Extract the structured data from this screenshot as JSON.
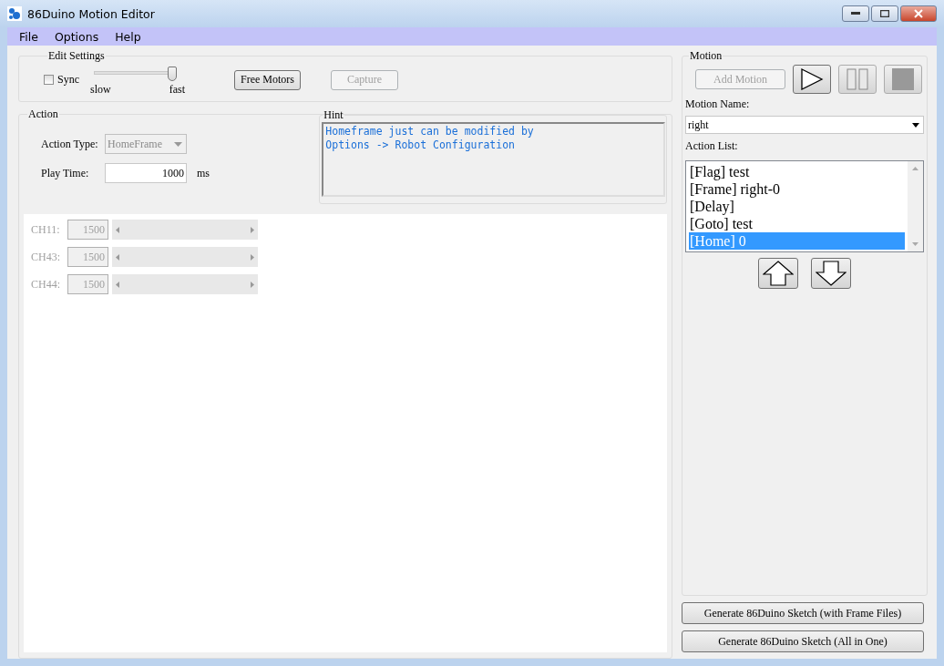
{
  "window": {
    "title": "86Duino Motion Editor"
  },
  "menu": [
    "File",
    "Options",
    "Help"
  ],
  "edit_settings": {
    "title": "Edit Settings",
    "sync": {
      "label": "Sync",
      "checked": false
    },
    "speed": {
      "level": 0.95,
      "min_label": "slow",
      "max_label": "fast"
    },
    "buttons": [
      {
        "label": "Free Motors",
        "disabled": false
      },
      {
        "label": "Capture",
        "disabled": true
      }
    ]
  },
  "action": {
    "title": "Action",
    "action_type": {
      "label": "Action Type:",
      "value": "HomeFrame",
      "disabled": true
    },
    "play_time": {
      "label": "Play Time:",
      "value": "1000",
      "unit": "ms"
    }
  },
  "hint": {
    "title": "Hint",
    "lines": [
      "Homeframe just can be modified by",
      "Options -> Robot Configuration"
    ]
  },
  "channels": [
    {
      "label": "CH11:",
      "value": "1500",
      "disabled": true
    },
    {
      "label": "CH43:",
      "value": "1500",
      "disabled": true
    },
    {
      "label": "CH44:",
      "value": "1500",
      "disabled": true
    }
  ],
  "motion": {
    "title": "Motion",
    "add_button": {
      "label": "Add Motion",
      "disabled": true
    },
    "motion_name": {
      "label": "Motion Name:",
      "value": "right"
    },
    "action_list": {
      "label": "Action List:",
      "items": [
        {
          "text": "[Flag] test",
          "selected": false
        },
        {
          "text": "[Frame] right-0",
          "selected": false
        },
        {
          "text": "[Delay]",
          "selected": false
        },
        {
          "text": "[Goto] test",
          "selected": false
        },
        {
          "text": "[Home] 0",
          "selected": true
        }
      ]
    }
  },
  "generate_buttons": [
    "Generate 86Duino Sketch (with Frame Files)",
    "Generate 86Duino Sketch (All in One)"
  ]
}
